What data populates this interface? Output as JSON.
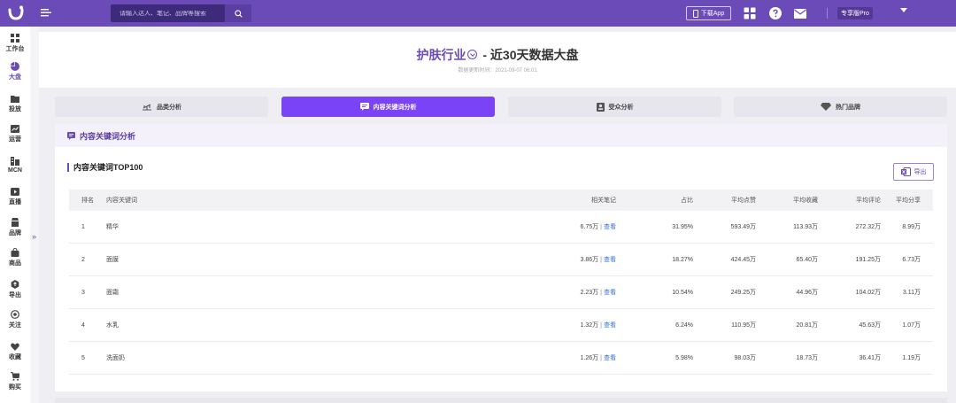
{
  "topbar": {
    "search_placeholder": "请输入达人、笔记、品牌等搜索",
    "download_label": "下载App",
    "user_badge": "专享版Pro"
  },
  "sidebar": {
    "items": [
      {
        "label": "工作台",
        "icon": "grid-icon"
      },
      {
        "label": "大盘",
        "icon": "pie-chart-icon"
      },
      {
        "label": "投放",
        "icon": "folder-icon"
      },
      {
        "label": "运营",
        "icon": "trend-icon"
      },
      {
        "label": "MCN",
        "icon": "building-icon"
      },
      {
        "label": "直播",
        "icon": "video-icon"
      },
      {
        "label": "品牌",
        "icon": "shop-icon"
      },
      {
        "label": "商品",
        "icon": "bag-icon"
      },
      {
        "label": "导出",
        "icon": "export-icon"
      },
      {
        "label": "关注",
        "icon": "eye-icon"
      },
      {
        "label": "收藏",
        "icon": "heart-icon"
      },
      {
        "label": "购买",
        "icon": "cart-icon"
      }
    ],
    "active_index": 1
  },
  "header": {
    "industry": "护肤行业",
    "title_suffix": " - 近30天数据大盘",
    "update_time": "数据更新时间：2021-09-07 06:01"
  },
  "tabs": [
    {
      "label": "品类分析",
      "icon": "scale-icon"
    },
    {
      "label": "内容关键词分析",
      "icon": "message-icon"
    },
    {
      "label": "受众分析",
      "icon": "profile-icon"
    },
    {
      "label": "热门品牌",
      "icon": "diamond-icon"
    }
  ],
  "active_tab": 1,
  "section": {
    "title": "内容关键词分析",
    "subtitle": "内容关键词TOP100",
    "export_label": "导出"
  },
  "table": {
    "columns": [
      "排名",
      "内容关键词",
      "相关笔记",
      "占比",
      "平均点赞",
      "平均收藏",
      "平均评论",
      "平均分享"
    ],
    "view_label": "查看",
    "rows": [
      {
        "rank": "1",
        "keyword": "精华",
        "notes": "6.75万",
        "ratio": "31.95%",
        "likes": "593.49万",
        "favs": "113.93万",
        "comments": "272.32万",
        "shares": "8.99万"
      },
      {
        "rank": "2",
        "keyword": "面膜",
        "notes": "3.86万",
        "ratio": "18.27%",
        "likes": "424.45万",
        "favs": "65.40万",
        "comments": "191.25万",
        "shares": "6.73万"
      },
      {
        "rank": "3",
        "keyword": "面霜",
        "notes": "2.23万",
        "ratio": "10.54%",
        "likes": "249.25万",
        "favs": "44.96万",
        "comments": "104.02万",
        "shares": "3.11万"
      },
      {
        "rank": "4",
        "keyword": "水乳",
        "notes": "1.32万",
        "ratio": "6.24%",
        "likes": "110.95万",
        "favs": "20.81万",
        "comments": "45.63万",
        "shares": "1.07万"
      },
      {
        "rank": "5",
        "keyword": "洗面奶",
        "notes": "1.26万",
        "ratio": "5.98%",
        "likes": "98.03万",
        "favs": "18.73万",
        "comments": "36.41万",
        "shares": "1.19万"
      }
    ]
  }
}
